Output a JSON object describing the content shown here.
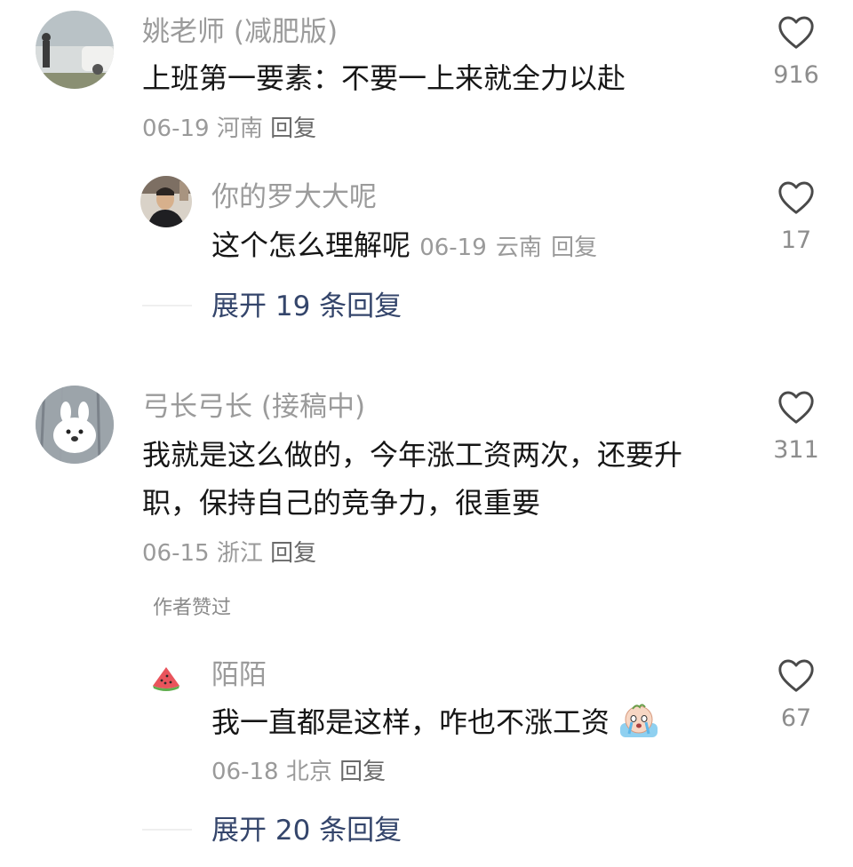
{
  "comments": [
    {
      "user": "姚老师 (减肥版)",
      "text": "上班第一要素：不要一上来就全力以赴",
      "date": "06-19",
      "location": "河南",
      "reply": "回复",
      "likes": "916",
      "reply_item": {
        "user": "你的罗大大呢",
        "text": "这个怎么理解呢",
        "date": "06-19",
        "location": "云南",
        "reply": "回复",
        "likes": "17"
      },
      "expand": "展开 19 条回复"
    },
    {
      "user": "弓长弓长 (接稿中)",
      "text_line1": "我就是这么做的，今年涨工资两次，还要升",
      "text_line2": "职，保持自己的竞争力，很重要",
      "date": "06-15",
      "location": "浙江",
      "reply": "回复",
      "likes": "311",
      "author_liked": "作者赞过",
      "reply_item": {
        "user": "陌陌",
        "text": "我一直都是这样，咋也不涨工资",
        "date": "06-18",
        "location": "北京",
        "reply": "回复",
        "likes": "67"
      },
      "expand": "展开 20 条回复"
    }
  ],
  "colors": {
    "username": "#9b9b9b",
    "body_text": "#161616",
    "expand_link": "#34456b"
  }
}
